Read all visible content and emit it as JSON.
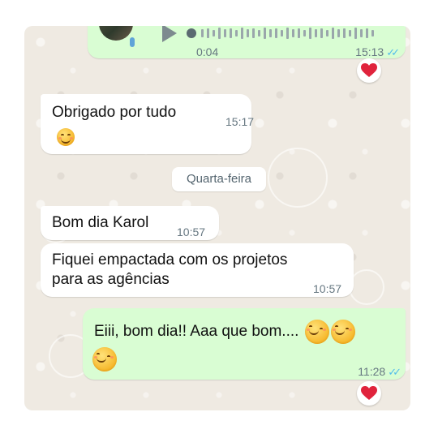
{
  "voice_note": {
    "duration": "0:04",
    "time": "15:13",
    "reaction": "❤️"
  },
  "messages": [
    {
      "text": "Obrigado por tudo",
      "time": "15:17",
      "emoji_line": "😊"
    },
    {
      "text": "Bom dia Karol",
      "time": "10:57"
    },
    {
      "line1": "Fiquei empactada com os projetos",
      "line2": "para as agências",
      "time": "10:57"
    },
    {
      "text": "Eiii, bom dia!! Aaa que bom....",
      "time": "11:28",
      "reaction": "❤️"
    }
  ],
  "day_separator": "Quarta-feira",
  "colors": {
    "incoming_bubble": "#ffffff",
    "outgoing_bubble": "#d9fdd3",
    "chat_background": "#efeae2",
    "read_ticks": "#53bdeb",
    "heart": "#e0233c"
  }
}
